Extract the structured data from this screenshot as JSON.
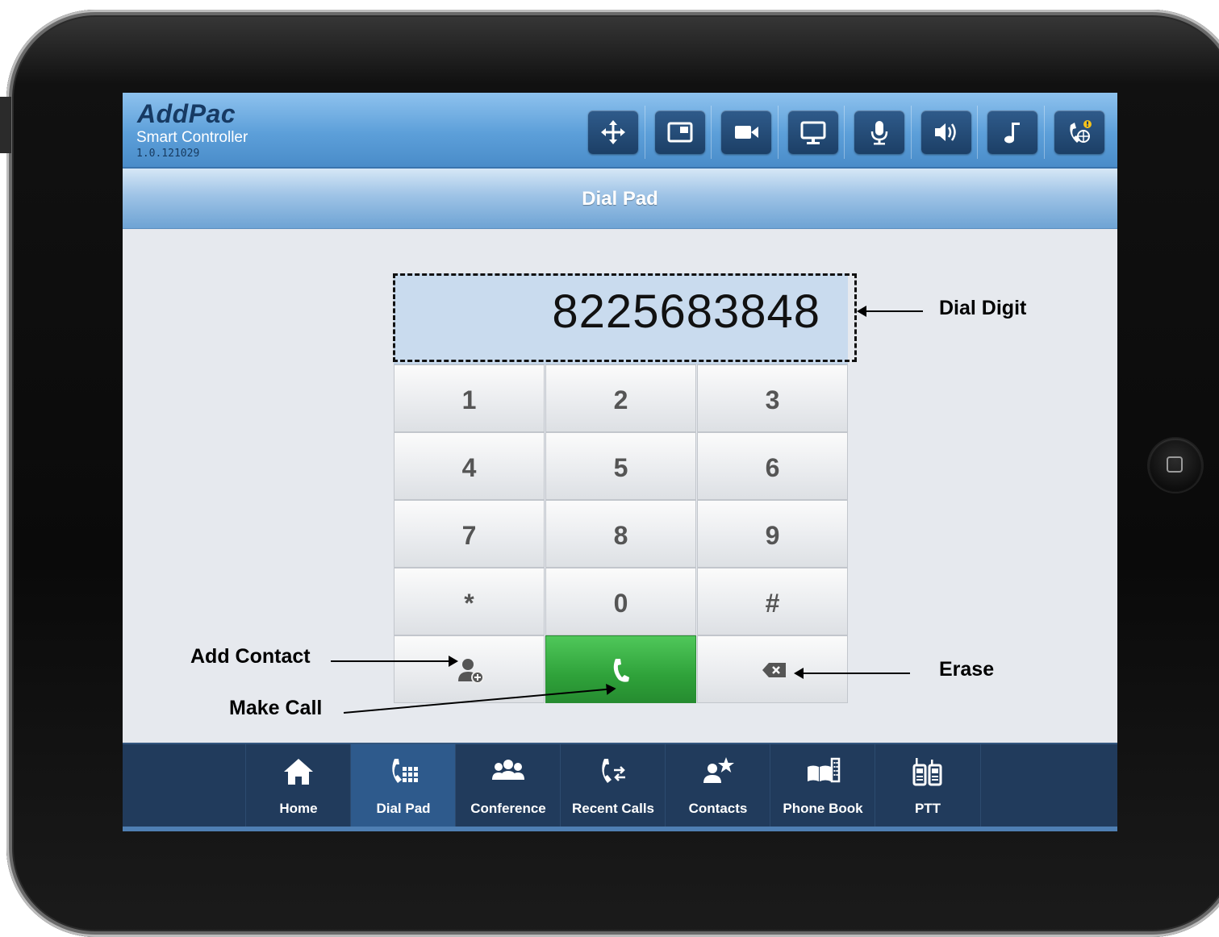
{
  "brand": {
    "logo": "AddPac",
    "product": "Smart Controller",
    "version": "1.0.121029"
  },
  "toolbar": {
    "icons": [
      "move-arrows-icon",
      "pip-window-icon",
      "video-camera-icon",
      "monitor-icon",
      "microphone-icon",
      "speaker-volume-icon",
      "music-note-icon",
      "phone-globe-alert-icon"
    ]
  },
  "page": {
    "title": "Dial Pad"
  },
  "dialer": {
    "display_digits": "8225683848",
    "keys": [
      "1",
      "2",
      "3",
      "4",
      "5",
      "6",
      "7",
      "8",
      "9",
      "*",
      "0",
      "#"
    ],
    "action_icons": [
      "add-contact-icon",
      "phone-handset-icon",
      "backspace-icon"
    ],
    "call_color": "#2fa23a"
  },
  "bottom_nav": {
    "tabs": [
      {
        "label": "Home",
        "icon": "home-icon"
      },
      {
        "label": "Dial Pad",
        "icon": "dialpad-phone-icon",
        "active": true
      },
      {
        "label": "Conference",
        "icon": "conference-people-icon"
      },
      {
        "label": "Recent Calls",
        "icon": "recent-calls-icon"
      },
      {
        "label": "Contacts",
        "icon": "contacts-star-icon"
      },
      {
        "label": "Phone Book",
        "icon": "phone-book-icon"
      },
      {
        "label": "PTT",
        "icon": "walkie-talkie-icon"
      }
    ]
  },
  "annotations": {
    "dial_digit": "Dial Digit",
    "add_contact": "Add Contact",
    "make_call": "Make Call",
    "erase": "Erase"
  }
}
